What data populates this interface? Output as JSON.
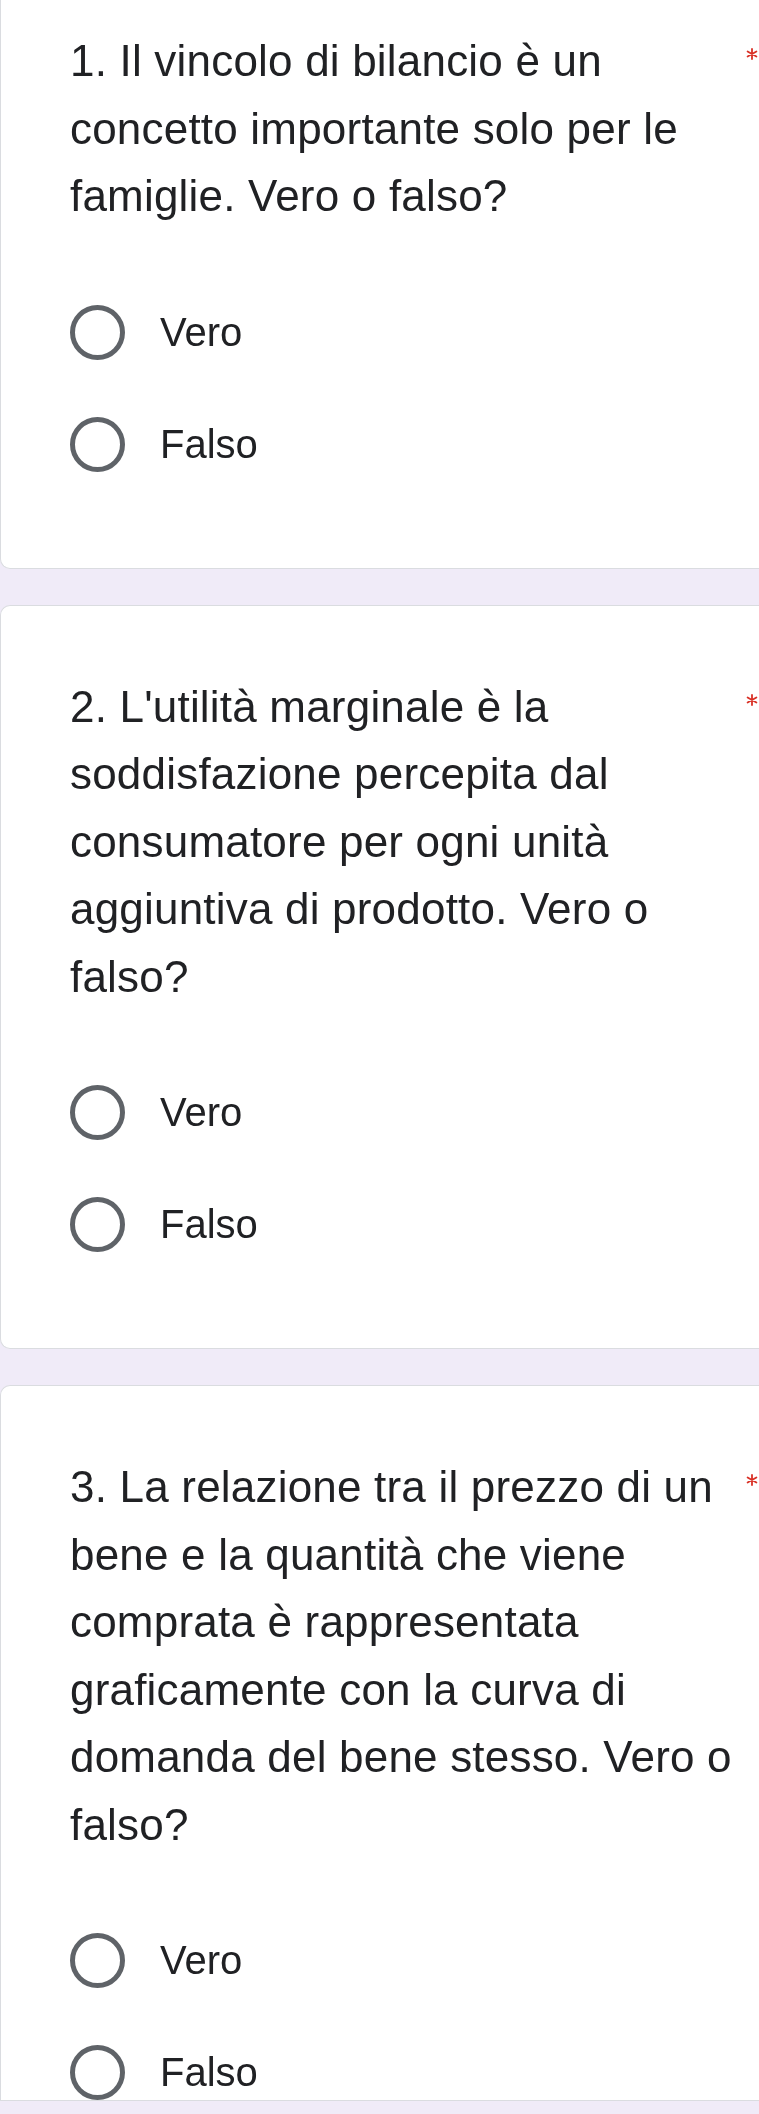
{
  "questions": [
    {
      "text": "1. Il vincolo di bilancio è un concetto importante solo per le famiglie. Vero o falso?",
      "required": true,
      "options": [
        {
          "label": "Vero",
          "selected": false
        },
        {
          "label": "Falso",
          "selected": false
        }
      ]
    },
    {
      "text": "2. L'utilità marginale è la soddisfazione percepita dal consumatore per ogni unità aggiuntiva di prodotto. Vero o falso?",
      "required": true,
      "options": [
        {
          "label": "Vero",
          "selected": false
        },
        {
          "label": "Falso",
          "selected": false
        }
      ]
    },
    {
      "text": "3. La relazione tra il prezzo di un bene e la quantità che viene comprata è rappresentata graficamente con la curva di domanda del bene stesso. Vero o falso?",
      "required": true,
      "options": [
        {
          "label": "Vero",
          "selected": false
        },
        {
          "label": "Falso",
          "selected": false
        }
      ]
    }
  ]
}
